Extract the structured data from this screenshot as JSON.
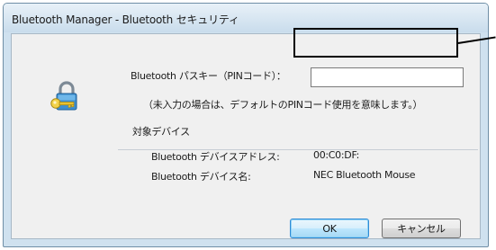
{
  "window": {
    "title": "Bluetooth Manager - Bluetooth セキュリティ"
  },
  "icons": {
    "security_icon": "key-lock-icon"
  },
  "form": {
    "pin_label": "Bluetooth パスキー（PINコード）：",
    "pin_value": "",
    "pin_note": "（未入力の場合は、デフォルトのPINコード使用を意味します。）"
  },
  "target_device": {
    "group_title": "対象デバイス",
    "address_label": "Bluetooth デバイスアドレス:",
    "address_value": "00:C0:DF:",
    "name_label": "Bluetooth デバイス名:",
    "name_value": "NEC Bluetooth Mouse"
  },
  "buttons": {
    "ok_label": "OK",
    "cancel_label": "キャンセル"
  },
  "colors": {
    "title_bar": "#c9dcec",
    "dialog_background": "#f0f0f0",
    "default_button_border": "#2f8bd6"
  }
}
